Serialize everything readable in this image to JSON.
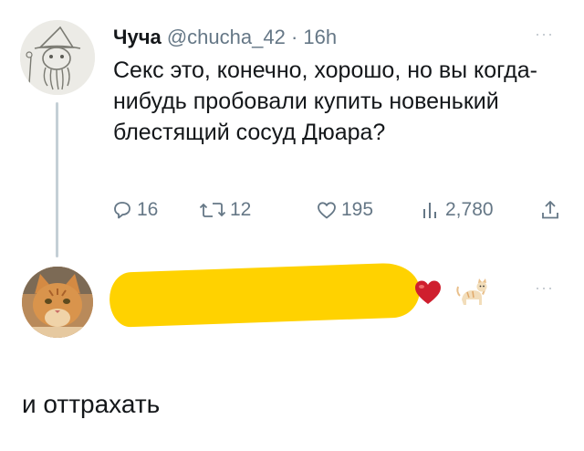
{
  "tweet": {
    "author_name": "Чуча",
    "author_handle": "@chucha_42",
    "separator": "·",
    "time": "16h",
    "text": "Секс это, конечно, хорошо, но вы когда-нибудь пробовали купить новенький блестящий сосуд Дюара?",
    "actions": {
      "replies": "16",
      "retweets": "12",
      "likes": "195",
      "views": "2,780"
    }
  },
  "more_menu": {
    "label": "···"
  },
  "reply": {
    "emojis": [
      "heart-emoji",
      "cat-emoji"
    ],
    "redaction_color": "#ffd200",
    "text": "и оттрахать"
  },
  "colors": {
    "text_primary": "#14171a",
    "text_secondary": "#657786",
    "thread_line": "#c4cfd6"
  }
}
